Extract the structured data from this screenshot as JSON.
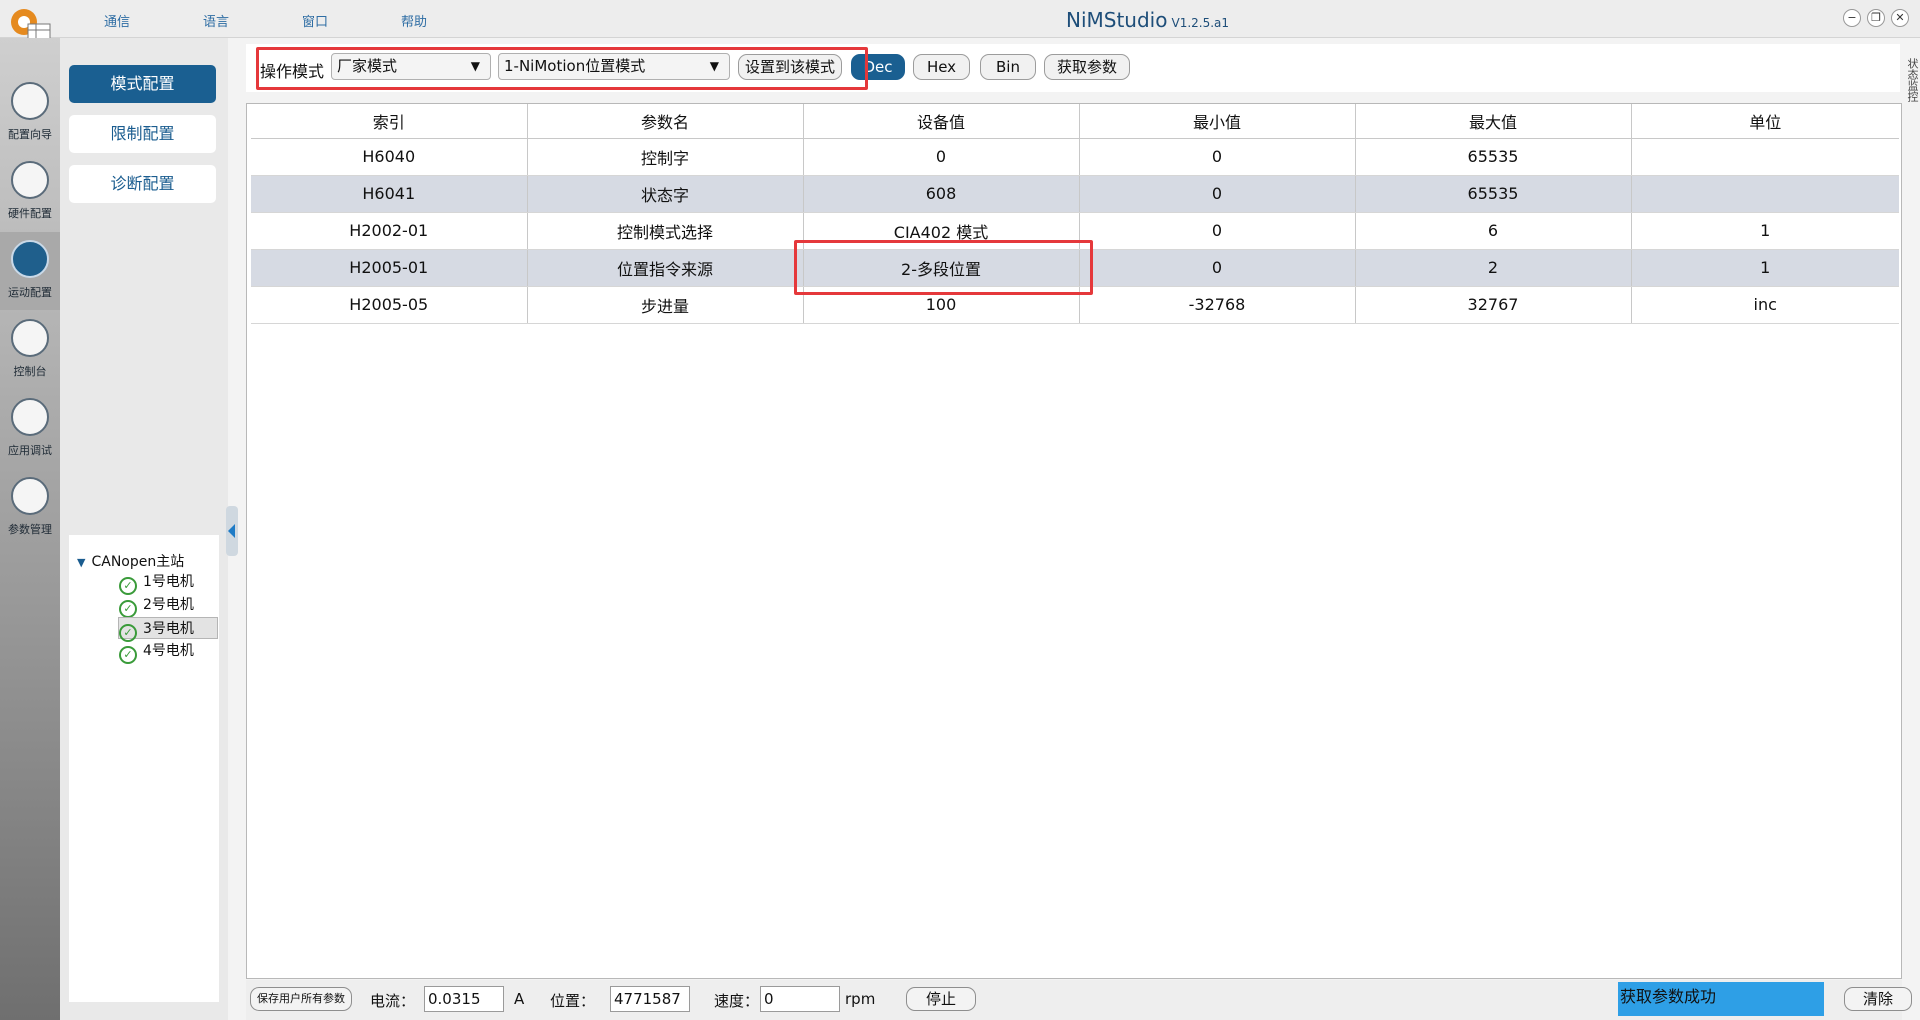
{
  "app": {
    "title": "NiMStudio",
    "version": "V1.2.5.a1"
  },
  "menu": [
    "通信",
    "语言",
    "窗口",
    "帮助"
  ],
  "rail": [
    {
      "label": "配置向导",
      "icon": "wizard-icon"
    },
    {
      "label": "硬件配置",
      "icon": "hardware-icon"
    },
    {
      "label": "运动配置",
      "icon": "motion-icon"
    },
    {
      "label": "控制台",
      "icon": "gauge-icon"
    },
    {
      "label": "应用调试",
      "icon": "sliders-icon"
    },
    {
      "label": "参数管理",
      "icon": "params-icon"
    }
  ],
  "nav": [
    "模式配置",
    "限制配置",
    "诊断配置"
  ],
  "tree": {
    "root": "CANopen主站",
    "items": [
      "1号电机",
      "2号电机",
      "3号电机",
      "4号电机"
    ],
    "selected": "3号电机"
  },
  "toolbar": {
    "mode_label": "操作模式",
    "mode_select": "厂家模式",
    "motion_select": "1-NiMotion位置模式",
    "set_mode_button": "设置到该模式",
    "dec": "Dec",
    "hex": "Hex",
    "bin": "Bin",
    "get_params": "获取参数"
  },
  "side_tab": "状态监控",
  "table": {
    "columns": [
      "索引",
      "参数名",
      "设备值",
      "最小值",
      "最大值",
      "单位"
    ],
    "rows": [
      [
        "H6040",
        "控制字",
        "0",
        "0",
        "65535",
        ""
      ],
      [
        "H6041",
        "状态字",
        "608",
        "0",
        "65535",
        ""
      ],
      [
        "H2002-01",
        "控制模式选择",
        "CIA402 模式",
        "0",
        "6",
        "1"
      ],
      [
        "H2005-01",
        "位置指令来源",
        "2-多段位置",
        "0",
        "2",
        "1"
      ],
      [
        "H2005-05",
        "步进量",
        "100",
        "-32768",
        "32767",
        "inc"
      ]
    ]
  },
  "status": {
    "save_button": "保存用户所有参数",
    "current_label": "电流：",
    "current_value": "0.0315",
    "current_unit": "A",
    "position_label": "位置：",
    "position_value": "4771587",
    "speed_label": "速度：",
    "speed_value": "0",
    "speed_unit": "rpm",
    "stop_button": "停止",
    "message": "获取参数成功",
    "clear_button": "清除"
  },
  "colors": {
    "accent": "#1a5f91",
    "highlight": "#e5383b",
    "status": "#2e9fe6",
    "alt_row": "#d6dae3"
  }
}
